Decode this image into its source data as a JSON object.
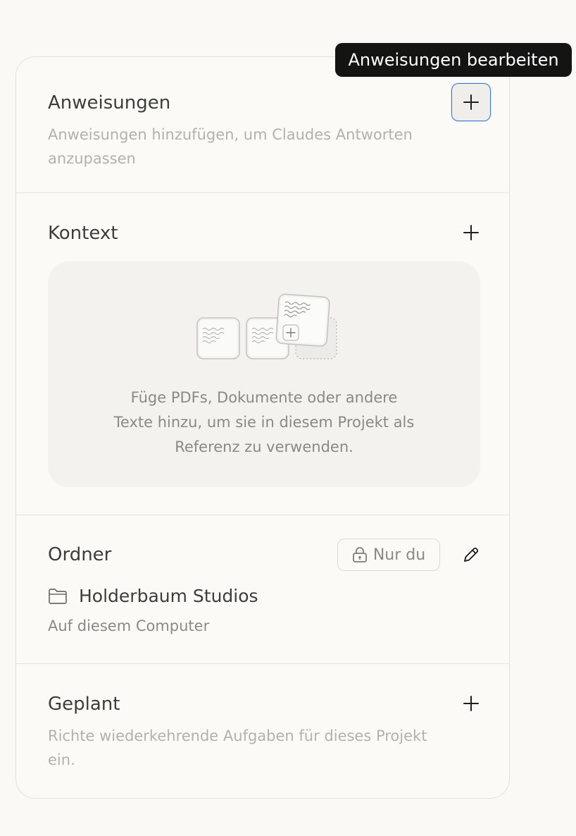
{
  "tooltip": {
    "text": "Anweisungen bearbeiten"
  },
  "instructions": {
    "title": "Anweisungen",
    "description": "Anweisungen hinzufügen, um Claudes Antworten anzupassen",
    "add_icon": "plus-icon"
  },
  "context": {
    "title": "Kontext",
    "add_icon": "plus-icon",
    "empty_line1": "Füge PDFs, Dokumente oder andere",
    "empty_line2": "Texte hinzu, um sie in diesem Projekt als",
    "empty_line3": "Referenz zu verwenden.",
    "illustration_icon": "documents-illustration-icon"
  },
  "folder": {
    "title": "Ordner",
    "visibility_label": "Nur du",
    "visibility_icon": "lock-icon",
    "edit_icon": "pencil-icon",
    "folder_icon": "folder-icon",
    "name": "Holderbaum Studios",
    "location": "Auf diesem Computer"
  },
  "scheduled": {
    "title": "Geplant",
    "description": "Richte wiederkehrende Aufgaben für dieses Projekt ein.",
    "add_icon": "plus-icon"
  },
  "colors": {
    "focus_ring": "#3b79d6",
    "tooltip_bg": "#141413",
    "panel_bg": "#fbfaf7"
  }
}
